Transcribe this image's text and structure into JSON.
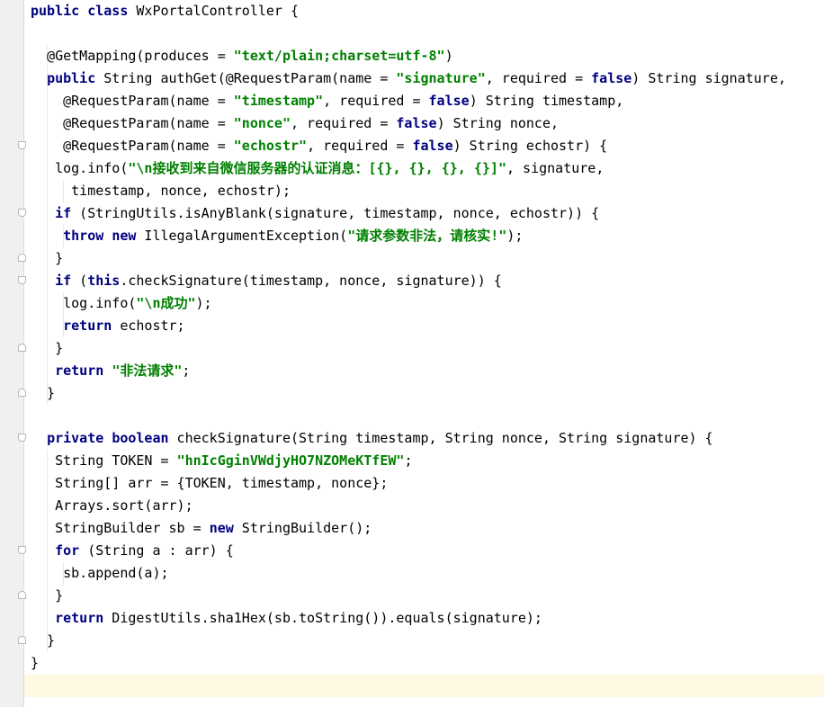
{
  "editor": {
    "file_language": "java",
    "lines": [
      [
        {
          "t": "kw",
          "v": "public"
        },
        {
          "t": "pl",
          "v": " "
        },
        {
          "t": "kw",
          "v": "class"
        },
        {
          "t": "pl",
          "v": " WxPortalController {"
        }
      ],
      [],
      [
        {
          "t": "pl",
          "v": "  @GetMapping(produces = "
        },
        {
          "t": "str",
          "v": "\"text/plain;charset=utf-8\""
        },
        {
          "t": "pl",
          "v": ")"
        }
      ],
      [
        {
          "t": "pl",
          "v": "  "
        },
        {
          "t": "kw",
          "v": "public"
        },
        {
          "t": "pl",
          "v": " String authGet(@RequestParam(name = "
        },
        {
          "t": "str",
          "v": "\"signature\""
        },
        {
          "t": "pl",
          "v": ", required = "
        },
        {
          "t": "kw",
          "v": "false"
        },
        {
          "t": "pl",
          "v": ") String signature,"
        }
      ],
      [
        {
          "t": "pl",
          "v": "    @RequestParam(name = "
        },
        {
          "t": "str",
          "v": "\"timestamp\""
        },
        {
          "t": "pl",
          "v": ", required = "
        },
        {
          "t": "kw",
          "v": "false"
        },
        {
          "t": "pl",
          "v": ") String timestamp,"
        }
      ],
      [
        {
          "t": "pl",
          "v": "    @RequestParam(name = "
        },
        {
          "t": "str",
          "v": "\"nonce\""
        },
        {
          "t": "pl",
          "v": ", required = "
        },
        {
          "t": "kw",
          "v": "false"
        },
        {
          "t": "pl",
          "v": ") String nonce,"
        }
      ],
      [
        {
          "t": "pl",
          "v": "    @RequestParam(name = "
        },
        {
          "t": "str",
          "v": "\"echostr\""
        },
        {
          "t": "pl",
          "v": ", required = "
        },
        {
          "t": "kw",
          "v": "false"
        },
        {
          "t": "pl",
          "v": ") String echostr) {"
        }
      ],
      [
        {
          "t": "pl",
          "v": "   log.info("
        },
        {
          "t": "str",
          "v": "\"\\n接收到来自微信服务器的认证消息：[{}, {}, {}, {}]\""
        },
        {
          "t": "pl",
          "v": ", signature,"
        }
      ],
      [
        {
          "t": "pl",
          "v": "     timestamp, nonce, echostr);"
        }
      ],
      [
        {
          "t": "pl",
          "v": "   "
        },
        {
          "t": "kw",
          "v": "if"
        },
        {
          "t": "pl",
          "v": " (StringUtils.isAnyBlank(signature, timestamp, nonce, echostr)) {"
        }
      ],
      [
        {
          "t": "pl",
          "v": "    "
        },
        {
          "t": "kw",
          "v": "throw"
        },
        {
          "t": "pl",
          "v": " "
        },
        {
          "t": "kw",
          "v": "new"
        },
        {
          "t": "pl",
          "v": " IllegalArgumentException("
        },
        {
          "t": "str",
          "v": "\"请求参数非法，请核实!\""
        },
        {
          "t": "pl",
          "v": ");"
        }
      ],
      [
        {
          "t": "pl",
          "v": "   }"
        }
      ],
      [
        {
          "t": "pl",
          "v": "   "
        },
        {
          "t": "kw",
          "v": "if"
        },
        {
          "t": "pl",
          "v": " ("
        },
        {
          "t": "kw",
          "v": "this"
        },
        {
          "t": "pl",
          "v": ".checkSignature(timestamp, nonce, signature)) {"
        }
      ],
      [
        {
          "t": "pl",
          "v": "    log.info("
        },
        {
          "t": "str",
          "v": "\"\\n成功\""
        },
        {
          "t": "pl",
          "v": ");"
        }
      ],
      [
        {
          "t": "pl",
          "v": "    "
        },
        {
          "t": "kw",
          "v": "return"
        },
        {
          "t": "pl",
          "v": " echostr;"
        }
      ],
      [
        {
          "t": "pl",
          "v": "   }"
        }
      ],
      [
        {
          "t": "pl",
          "v": "   "
        },
        {
          "t": "kw",
          "v": "return"
        },
        {
          "t": "pl",
          "v": " "
        },
        {
          "t": "str",
          "v": "\"非法请求\""
        },
        {
          "t": "pl",
          "v": ";"
        }
      ],
      [
        {
          "t": "pl",
          "v": "  }"
        }
      ],
      [],
      [
        {
          "t": "pl",
          "v": "  "
        },
        {
          "t": "kw",
          "v": "private"
        },
        {
          "t": "pl",
          "v": " "
        },
        {
          "t": "kw",
          "v": "boolean"
        },
        {
          "t": "pl",
          "v": " checkSignature(String timestamp, String nonce, String signature) {"
        }
      ],
      [
        {
          "t": "pl",
          "v": "   String TOKEN = "
        },
        {
          "t": "str",
          "v": "\"hnIcGginVWdjyHO7NZOMeKTfEW\""
        },
        {
          "t": "pl",
          "v": ";"
        }
      ],
      [
        {
          "t": "pl",
          "v": "   String[] arr = {TOKEN, timestamp, nonce};"
        }
      ],
      [
        {
          "t": "pl",
          "v": "   Arrays.sort(arr);"
        }
      ],
      [
        {
          "t": "pl",
          "v": "   StringBuilder sb = "
        },
        {
          "t": "kw",
          "v": "new"
        },
        {
          "t": "pl",
          "v": " StringBuilder();"
        }
      ],
      [
        {
          "t": "pl",
          "v": "   "
        },
        {
          "t": "kw",
          "v": "for"
        },
        {
          "t": "pl",
          "v": " (String a : arr) {"
        }
      ],
      [
        {
          "t": "pl",
          "v": "    sb.append(a);"
        }
      ],
      [
        {
          "t": "pl",
          "v": "   }"
        }
      ],
      [
        {
          "t": "pl",
          "v": "   "
        },
        {
          "t": "kw",
          "v": "return"
        },
        {
          "t": "pl",
          "v": " DigestUtils.sha1Hex(sb.toString()).equals(signature);"
        }
      ],
      [
        {
          "t": "pl",
          "v": "  }"
        }
      ],
      [
        {
          "t": "pl",
          "v": "}"
        }
      ],
      []
    ]
  },
  "colors": {
    "keyword": "#000080",
    "string": "#008000",
    "gutter": "#f0f0f0",
    "caret_line": "#fdf9e3"
  }
}
